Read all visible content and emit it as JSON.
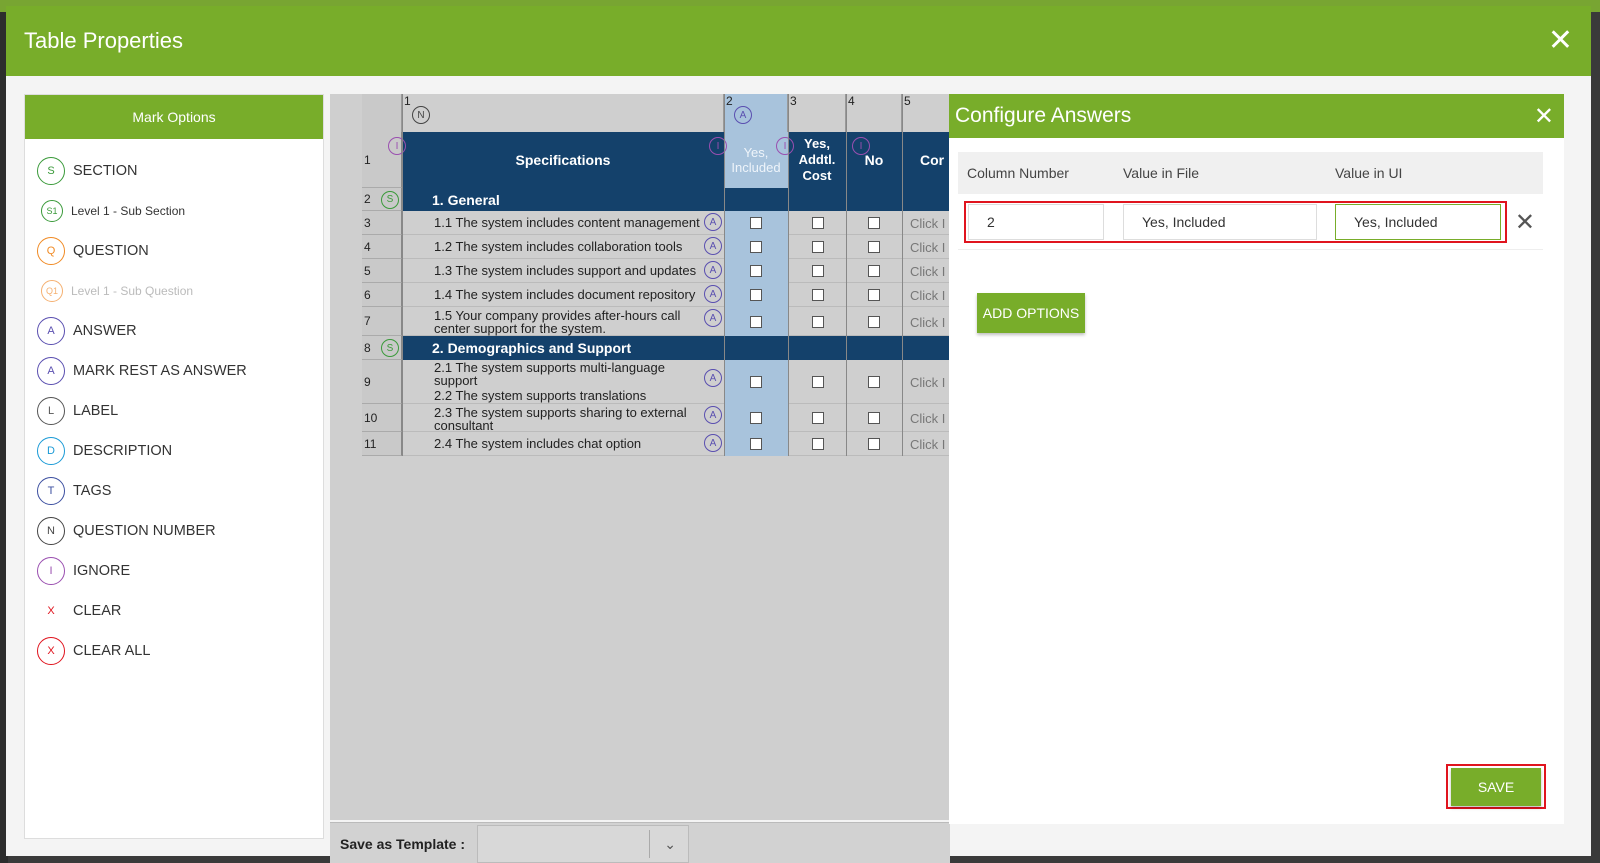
{
  "modal": {
    "title": "Table Properties",
    "close_icon": "close-icon"
  },
  "mark_panel": {
    "title": "Mark Options",
    "items": [
      {
        "badge": "S",
        "label": "SECTION",
        "color": "#3a9a3a"
      },
      {
        "badge": "S1",
        "label": "Level 1 - Sub Section",
        "color": "#3a9a3a"
      },
      {
        "badge": "Q",
        "label": "QUESTION",
        "color": "#f08a24"
      },
      {
        "badge": "Q1",
        "label": "Level 1 - Sub Question",
        "color": "#f5b070"
      },
      {
        "badge": "A",
        "label": "ANSWER",
        "color": "#5a4fb0"
      },
      {
        "badge": "A",
        "label": "MARK REST AS ANSWER",
        "color": "#5a4fb0"
      },
      {
        "badge": "L",
        "label": "LABEL",
        "color": "#555555"
      },
      {
        "badge": "D",
        "label": "DESCRIPTION",
        "color": "#1a9ad6"
      },
      {
        "badge": "T",
        "label": "TAGS",
        "color": "#3c4fa0"
      },
      {
        "badge": "N",
        "label": "QUESTION NUMBER",
        "color": "#444444"
      },
      {
        "badge": "I",
        "label": "IGNORE",
        "color": "#9a4fb0"
      },
      {
        "badge": "X",
        "label": "CLEAR",
        "color": "#e0141e"
      },
      {
        "badge": "X",
        "label": "CLEAR ALL",
        "color": "#e0141e"
      }
    ]
  },
  "table": {
    "col_numbers": [
      "1",
      "2",
      "3",
      "4",
      "5"
    ],
    "header_badges": {
      "col1": "N",
      "col2": "A",
      "row_ignore": "I"
    },
    "headers": {
      "specifications": "Specifications",
      "yes_included": "Yes, Included",
      "yes_addtl": "Yes, Addtl. Cost",
      "no": "No",
      "comments": "Cor"
    },
    "rows": [
      {
        "num": "1"
      },
      {
        "num": "2",
        "section": "1.  General",
        "badge": "S"
      },
      {
        "num": "3",
        "text": "1.1  The system includes content management"
      },
      {
        "num": "4",
        "text": "1.2  The system includes collaboration tools"
      },
      {
        "num": "5",
        "text": "1.3  The system includes support and updates"
      },
      {
        "num": "6",
        "text": "1.4  The system includes document repository"
      },
      {
        "num": "7",
        "text": "1.5  Your company provides after-hours call center support for the system."
      },
      {
        "num": "8",
        "section": "2.  Demographics and Support",
        "badge": "S"
      },
      {
        "num": "9",
        "text": "2.1  The system supports multi-language support",
        "text2": "2.2  The system supports translations"
      },
      {
        "num": "10",
        "text": "2.3  The system supports sharing to external consultant"
      },
      {
        "num": "11",
        "text": "2.4  The system includes chat option"
      }
    ],
    "answer_badge": "A",
    "click_text": "Click I"
  },
  "template": {
    "label": "Save as Template :",
    "value": ""
  },
  "configure": {
    "title": "Configure Answers",
    "columns": [
      "Column Number",
      "Value in File",
      "Value in UI"
    ],
    "row": {
      "column_number": "2",
      "value_in_file": "Yes, Included",
      "value_in_ui": "Yes, Included"
    },
    "add_label": "ADD OPTIONS",
    "save_label": "SAVE"
  }
}
